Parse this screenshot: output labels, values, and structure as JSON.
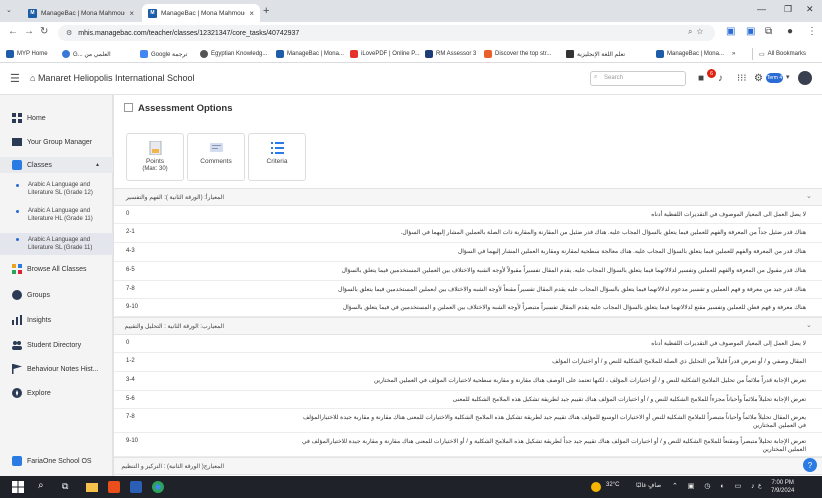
{
  "browser": {
    "tabs": [
      {
        "label": "ManageBac | Mona Mahmoud"
      },
      {
        "label": "ManageBac | Mona Mahmoud"
      }
    ],
    "url": "mhis.managebac.com/teacher/classes/12321347/core_tasks/40742937",
    "bookmarks": [
      "MYP Home",
      "G... العلمي من",
      "Google ترجمة",
      "Egyptian Knowledg...",
      "ManageBac | Mona...",
      "iLovePDF | Online P...",
      "RM Assessor 3",
      "Discover the top str...",
      "تعلم اللغة الإنجليزية",
      "ManageBac | Mona...",
      "All Bookmarks"
    ]
  },
  "header": {
    "school": "Manaret Heliopolis International School",
    "search_placeholder": "Search",
    "notification_count": "6",
    "term_label": "Term 4"
  },
  "sidebar": {
    "items": [
      {
        "label": "Home"
      },
      {
        "label": "Your Group Manager"
      },
      {
        "label": "Classes"
      },
      {
        "label": "Browse All Classes"
      },
      {
        "label": "Groups"
      },
      {
        "label": "Insights"
      },
      {
        "label": "Student Directory"
      },
      {
        "label": "Behaviour Notes Hist..."
      },
      {
        "label": "Explore"
      },
      {
        "label": "FariaOne School OS"
      }
    ],
    "classes": [
      {
        "line1": "Arabic A Language and",
        "line2": "Literature SL (Grade 12)"
      },
      {
        "line1": "Arabic A Language and",
        "line2": "Literature HL (Grade 11)"
      },
      {
        "line1": "Arabic A Language and",
        "line2": "Literature SL (Grade 11)"
      }
    ]
  },
  "main": {
    "title": "Assessment Options",
    "options": [
      {
        "label": "Points",
        "sub": "(Max: 30)"
      },
      {
        "label": "Comments"
      },
      {
        "label": "Criteria"
      }
    ],
    "sections": [
      {
        "title": "المعيارأ: (الورقة الثانية ): الفهم والتفسير",
        "rows": [
          {
            "range": "0",
            "text": "لا يصل العمل الى المعيار الموصوف في التقديرات اللفظية أدناه"
          },
          {
            "range": "2-1",
            "text": "هناك قدر ضئيل جداً من المعرفة والفهم للعملين فيما يتعلق بالسؤال المجاب عليه. هناك قدر ضئيل من المقارنة والمقاربة ذات الصلة بالعملين المشار إليهما في السؤال."
          },
          {
            "range": "4-3",
            "text": "هناك قدر من المعرفة والفهم للعملين فيما يتعلق بالسؤال المجاب عليه. هناك معالجة سطحية لمقارنة ومقاربة العملين المشار إليهما في السؤال"
          },
          {
            "range": "6-5",
            "text": "هناك قدر مقبول من المعرفة والفهم للعملين وتفسير لدلالاتهما فيما يتعلق بالسؤال المجاب عليه. يقدم المقال تفسيراً مقبولاً لأوجه الشبه والاختلاف بين العملين المستخدمين فيما يتعلق بالسؤال"
          },
          {
            "range": "7-8",
            "text": "هناك قدر جيد من معرفة و فهم العملين و تفسير مدعوم لدلالاتهما فيما يتعلق بالسؤال المجاب عليه يقدم المقال تفسيراً مقنعاً لأوجه الشبه والاختلاف بين ابعملين المستخدمين فيما يتعلق بالسؤال"
          },
          {
            "range": "9-10",
            "text": "هناك معرفة و فهم فطن للعملين وتفسير مقنع لدلالاتهما فيما يتعلق بالسؤال المجاب عليه يقدم المقال تفسيراً متبصراً لأوجه الشبه والاختلاف بين العملين و المستخدمين في فيما يتعلق بالسؤال"
          }
        ]
      },
      {
        "title": "المعيارب: الورقة الثانية : التحليل والتقييم",
        "rows": [
          {
            "range": "0",
            "text": "لا يصل العمل إلى المعيار الموصوف في التقديرات اللفظية أدناه"
          },
          {
            "range": "1-2",
            "text": "المقال وصفي و / أو تعرض قدراً قليلاً من التحليل ذي الصلة للملامح الشكلية للنص و / أو اختيارات المؤلف"
          },
          {
            "range": "3-4",
            "text": "تعرض الإجابة قدراً ملائماً من تحليل الملامح الشكلية للنص و / أو اختيارات المؤلف ، لكنها تعتمد على الوصف هناك مقارنة و مقاربة سطحية لاختيارات المؤلف في العملين المختارين"
          },
          {
            "range": "5-6",
            "text": "تعرض الإجابة تحليلاً ملائماً وأحياناً مجزءاً للملامح الشكلية للنص و / أو اختيارات المؤلف هناك تقييم جيد لطريقة تشكيل هذه الملامح الشكلية للمعنى"
          },
          {
            "range": "7-8",
            "text": "يعرض المقال تحليلاً ملائماً وأحياناً متبصراً للملامح الشكلية للنص أو الاختيارات الوسيع للمؤلف هناك تقييم جيد لطريقة تشكيل هذه الملامح الشكلية والاختيارات للمعنى هناك مقارنة و مقاربة جيدة للاختيارالمؤلف في العملين المختارين"
          },
          {
            "range": "9-10",
            "text": "تعرض الإجابة تحليلاً متبصراً ومقنعاً للملامح الشكلية للنص و / أو اختيارات المؤلف هناك تقييم جيد جداً لطريقة تشكيل هذه الملامح الشكلية و / أو الاختيارات للمعنى هناك مقارنة و مقاربة جيدة للاختيارالمؤلف في العملين المختارين"
          }
        ]
      },
      {
        "title": "المعيارج( الورقة الثانية) : التركيز و التنظيم",
        "rows": []
      }
    ]
  },
  "taskbar": {
    "weather": "32°C",
    "weather_desc": "صافٍ غالبًا",
    "time": "7:00 PM",
    "date": "7/9/2024"
  }
}
